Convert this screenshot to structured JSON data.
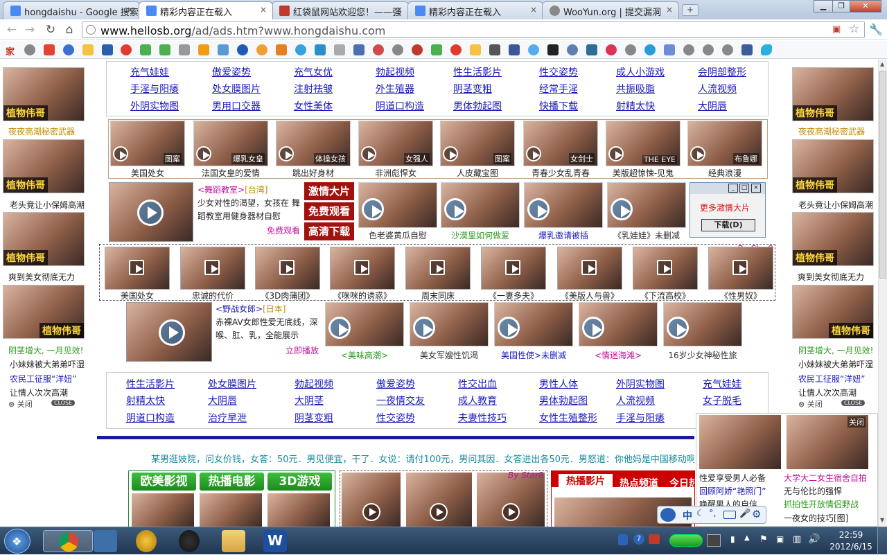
{
  "browser": {
    "tabs": [
      {
        "label": "hongdaishu - Google 搜索",
        "color": "#4a8af4"
      },
      {
        "label": "精彩内容正在载入",
        "color": "#4a8af4"
      },
      {
        "label": "红袋鼠网站欢迎您！——强",
        "color": "#c0392b"
      },
      {
        "label": "精彩内容正在载入",
        "color": "#4a8af4"
      },
      {
        "label": "WooYun.org | 提交漏洞",
        "color": "#888888"
      }
    ],
    "url_host": "www.hellosb.org",
    "url_path": "/ad/ads.htm?www.hongdaishu.com"
  },
  "top_links": [
    [
      "充气娃娃",
      "傲爱姿势",
      "充气女优",
      "勃起视频",
      "性生活影片",
      "性交姿势",
      "成人小游戏",
      "会阴部整形"
    ],
    [
      "手淫与阳痿",
      "处女膜图片",
      "注射祛皱",
      "外生殖器",
      "阴茎变粗",
      "经常手淫",
      "共振吸脂",
      "人流视频"
    ],
    [
      "外阴实物图",
      "男用口交器",
      "女性美体",
      "阴道口构造",
      "男体勃起图",
      "快播下载",
      "射精太快",
      "大阴唇"
    ]
  ],
  "photo_row": [
    {
      "caption": "美国处女",
      "tag": "图案"
    },
    {
      "caption": "法国女皇的爱情",
      "tag": "爆乳女皇"
    },
    {
      "caption": "跳出好身材",
      "tag": "体操女孩"
    },
    {
      "caption": "非洲彪悍女",
      "tag": "女强人"
    },
    {
      "caption": "人皮藏宝图",
      "tag": "图案"
    },
    {
      "caption": "青春少女乱青春",
      "tag": "女剑士"
    },
    {
      "caption": "美版超惊悚-见鬼",
      "tag": "THE EYE"
    },
    {
      "caption": "经典浪漫",
      "tag": "布鲁娜"
    }
  ],
  "dance": {
    "title": "<舞蹈教室>",
    "region": "[台湾]",
    "desc": "少女对性的渴望，女孩在 舞蹈教室用健身器材自慰",
    "free": "免费观看",
    "buttons": [
      "激情大片",
      "免费观看",
      "高清下载"
    ]
  },
  "row2": [
    {
      "caption": "色老婆黄瓜自慰"
    },
    {
      "caption": "沙漠里如何做爱"
    },
    {
      "caption": "爆乳邀请被插"
    },
    {
      "caption": "《乳娃娃》未删减"
    }
  ],
  "popup": {
    "title": "更多激情大片",
    "button": "下载(D)"
  },
  "strip": {
    "badge": "By Star8",
    "items": [
      "美国处女",
      "忠诚的代价",
      "《3D肉蒲团》",
      "《咪咪的诱惑》",
      "周末同床",
      "《一妻多夫》",
      "《美版人与兽》",
      "《下流高校》",
      "《性男奴》"
    ]
  },
  "wild": {
    "title": "<野战女郎>",
    "region": "[日本]",
    "desc": "赤裸AV女郎性爱无底线，深喉、肛、乳，全能展示",
    "play": "立即播放",
    "items": [
      "<美味高潮>",
      "美女军嫂性饥渴",
      "美国性使>未删减",
      "<情迷海滩>",
      "16岁少女神秘性旅"
    ]
  },
  "bottom_links": [
    [
      "性生活影片",
      "处女膜图片",
      "勃起视频",
      "傲爱姿势",
      "性交出血",
      "男性人体",
      "外阴实物图",
      "充气娃娃"
    ],
    [
      "射精太快",
      "大阴唇",
      "大阴茎",
      "一夜情交友",
      "成人教育",
      "男体勃起图",
      "人流视频",
      "女子脱毛"
    ],
    [
      "阴道口构造",
      "治疗早泄",
      "阴茎变粗",
      "性交姿势",
      "夫妻性技巧",
      "女性生殖整形",
      "手淫与阳痿",
      ""
    ]
  ],
  "marquee": "某男逛妓院，问女价钱，女答：50元．男见便宜，干了．女说：请付100元，男问其因．女答进出各50元．男怒道：你他妈是中国移动啊，还双",
  "lower_tabs": [
    "欧美影视",
    "热播电影",
    "3D游戏"
  ],
  "hot_tabs": [
    "热播影片",
    "热点频道",
    "今日热"
  ],
  "left_side": {
    "ad_label": "植物伟哥",
    "captions": [
      "夜夜高潮秘密武器",
      "老头竟让小保姆高潮",
      "爽到美女彻底无力"
    ],
    "promo1": "阴茎增大, 一月见效!",
    "promo2": "小妹妹被大弟弟吓湿",
    "promo3": "农民工征服“洋妞”",
    "promo4": "让情人次次高潮",
    "close": "⊗ 关闭",
    "close_en": "CLOSE"
  },
  "right_side": {
    "ad_label": "植物伟哥",
    "captions": [
      "夜夜高潮秘密武器",
      "老头竟让小保姆高潮",
      "爽到美女彻底无力"
    ],
    "promo1": "阴茎增大, 一月见效!",
    "promo2": "小妹妹被大弟弟吓湿",
    "promo3": "农民工征服“洋妞”",
    "promo4": "让情人次次高潮",
    "close": "⊗ 关闭",
    "close_en": "CLOSE"
  },
  "corner_ad": {
    "close": "关闭",
    "lines_left": [
      "性爱享受男人必备",
      "回顾阿娇“艳照门”",
      "唤醒男人的自信"
    ],
    "lines_right": [
      "大学大二女生宿舍自拍",
      "无与伦比的强悍",
      "抓拍性开放情侣野战",
      "一夜女的技巧[图]"
    ]
  },
  "ime": {
    "label": "中"
  },
  "taskbar": {
    "time": "22:59",
    "date": "2012/6/15"
  }
}
